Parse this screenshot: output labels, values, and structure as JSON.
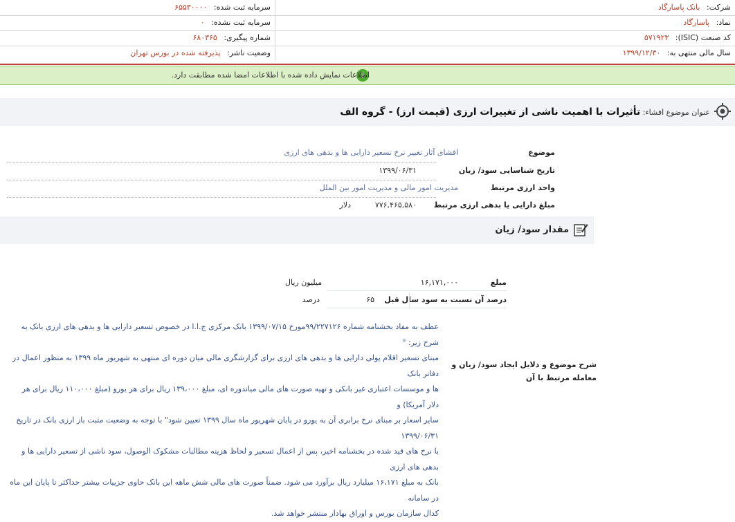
{
  "header": {
    "company_label": "شرکت:",
    "company_value": "بانک پاسارگاد",
    "registered_capital_label": "سرمایه ثبت شده:",
    "registered_capital_value": "۶۵۵۳۰۰۰۰",
    "symbol_label": "نماد:",
    "symbol_value": "پاسارگاد",
    "unregistered_capital_label": "سرمایه ثبت نشده:",
    "unregistered_capital_value": "۰",
    "isic_label": "کد صنعت (ISIC):",
    "isic_value": "۵۷۱۹۲۳",
    "tracking_label": "شماره پیگیری:",
    "tracking_value": "۶۸۰۳۶۵",
    "fiscal_label": "سال مالی منتهی به:",
    "fiscal_value": "۱۳۹۹/۱۲/۳۰",
    "publisher_status_label": "وضعیت ناشر:",
    "publisher_status_value": "پذیرفته شده در بورس تهران"
  },
  "notice": {
    "text": "اطلاعات نمایش داده شده با اطلاعات امضا شده مطابقت دارد.",
    "icon": "info-icon",
    "color": "#4caa2c"
  },
  "disclosure": {
    "subject_label": "عنوان موضوع افشاء:",
    "subject_value": "تأثیرات با اهمیت ناشی از تغییرات ارزی (قیمت ارز) - گروه الف"
  },
  "fields": {
    "topic_label": "موضوع",
    "topic_value": "افشای آثار تغییر نرخ تسعیر دارایی ها و بدهی های ارزی",
    "date_label": "تاریخ شناسایی سود/ زیان",
    "date_value": "۱۳۹۹/۰۶/۳۱",
    "unit_label": "واحد ارزی مرتبط",
    "unit_value": "مدیریت امور مالی و مدیریت امور بین الملل",
    "amount_label": "مبلغ دارایی یا بدهی ارزی مرتبط",
    "amount_value": "۷۷۶,۴۶۵,۵۸۰",
    "amount_currency": "دلار"
  },
  "profit_section": {
    "title": "مقدار سود/ زیان",
    "amount_label": "مبلغ",
    "amount_value": "۱۶,۱۷۱,۰۰۰",
    "amount_unit": "میلیون ریال",
    "percent_label": "درصد آن نسبت به سود سال قبل",
    "percent_value": "۶۵",
    "percent_unit": "درصد"
  },
  "description": {
    "label": "شرح موضوع و دلایل ایجاد سود/ زیان و معامله مرتبط با آن",
    "lines": [
      "عطف به مفاد بخشنامه شماره ۹۹/۲۲۷۱۲۶مورخ ۱۳۹۹/۰۷/۱۵ بانک مرکزی ج.ا.ا در خصوص تسعیر دارایی ها و بدهی های ارزی بانک به شرح زیر: \"",
      "مبنای تسعیر اقلام پولی دارایی ها و بدهی های ارزی برای گزارشگری مالی میان دوره ای منتهی به شهریور ماه ۱۳۹۹ به منظور اعمال در دفاتر بانک",
      "ها و موسسات اعتباری غیر بانکی و تهیه صورت های مالی میاندوره ای، مبلغ ۱۳۹،۰۰۰ ریال برای هر یورو (مبلغ ۱۱۰،۰۰۰ ریال برای هر دلار آمریکا) و",
      "سایر اسعار بر مبنای نرخ برابری آن به یورو در پایان شهریور ماه سال ۱۳۹۹ تعیین شود\" با توجه به وضعیت مثبت باز ارزی بانک در تاریخ ۱۳۹۹/۰۶/۳۱",
      "با نرخ های قید شده در بخشنامه اخیر، پس از اعمال تسعیر و لحاظ هزینه مطالبات مشکوک الوصول، سود ناشی از تسعیر دارایی ها و بدهی های ارزی",
      "بانک به مبلغ ۱۶،۱۷۱ میلیارد ریال برآورد می شود. ضمناً صورت های مالی شش ماهه این بانک حاوی جزییات بیشتر حداکثر تا پایان این ماه در سامانه",
      "کدال سازمان بورس و اوراق بهادار منتشر خواهد شد."
    ]
  }
}
